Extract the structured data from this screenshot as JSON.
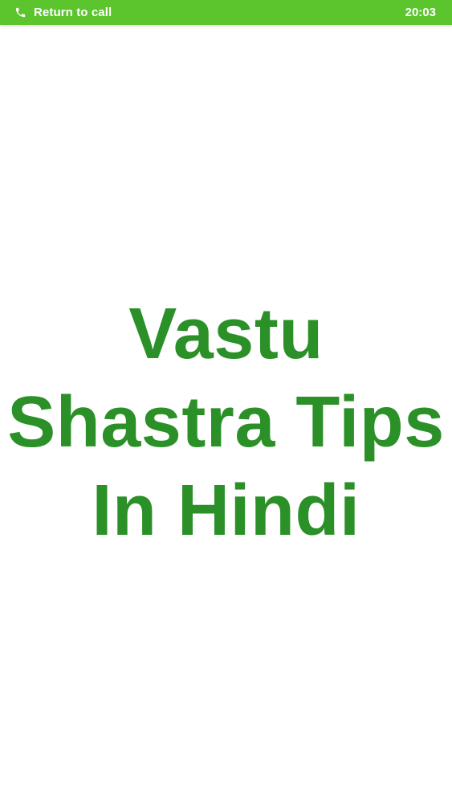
{
  "status_bar": {
    "call_label": "Return to call",
    "time": "20:03",
    "call_icon": "phone-icon",
    "background_color": "#5cc42c"
  },
  "splash": {
    "title_lines": [
      "Vastu",
      "Shastra Tips",
      "In Hindi"
    ],
    "title_color": "#2a9027"
  }
}
